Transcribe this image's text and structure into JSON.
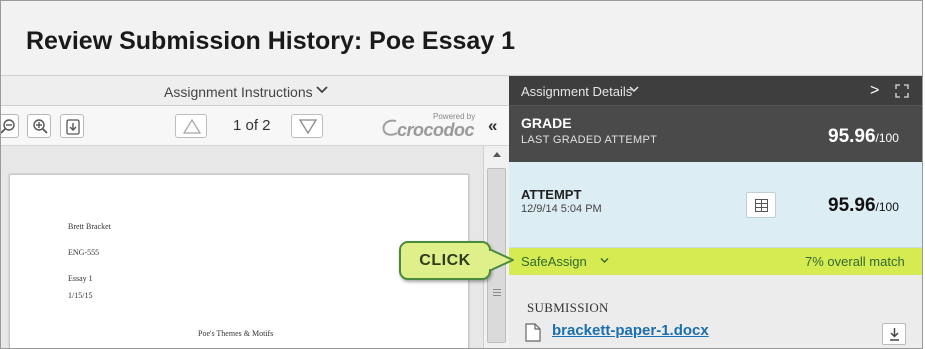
{
  "page": {
    "title": "Review Submission History: Poe Essay 1"
  },
  "left_pane": {
    "instructions_label": "Assignment Instructions",
    "pager_text": "1 of 2",
    "powered_by": "Powered by",
    "brand": "crocodoc",
    "collapse_glyph": "«"
  },
  "document": {
    "lines": [
      "Brett Bracket",
      "ENG-555",
      "Essay 1",
      "1/15/15",
      "Poe's Themes & Motifs"
    ]
  },
  "right_pane": {
    "details_label": "Assignment Details",
    "next_glyph": ">",
    "grade": {
      "label": "GRADE",
      "sub_label": "LAST GRADED ATTEMPT",
      "score": "95.96",
      "total": "/100"
    },
    "attempt": {
      "label": "ATTEMPT",
      "date": "12/9/14 5:04 PM",
      "score": "95.96",
      "total": "/100"
    },
    "safeassign": {
      "label": "SafeAssign",
      "match": "7% overall match"
    },
    "submission": {
      "label": "SUBMISSION",
      "file_name": "brackett-paper-1.docx"
    }
  },
  "callout": {
    "text": "CLICK"
  },
  "colors": {
    "header_bg": "#f2f2f2",
    "grade_bg": "#4a4a4a",
    "attempt_bg": "#dcedf3",
    "safeassign_bg": "#d6ea52",
    "link": "#1a6fb0",
    "callout_border": "#4b8a3b"
  },
  "icons": [
    "zoom-out-icon",
    "zoom-in-icon",
    "download-icon",
    "triangle-up-icon",
    "triangle-down-icon",
    "chevron-down-icon",
    "expand-icon",
    "grid-icon",
    "file-icon"
  ]
}
